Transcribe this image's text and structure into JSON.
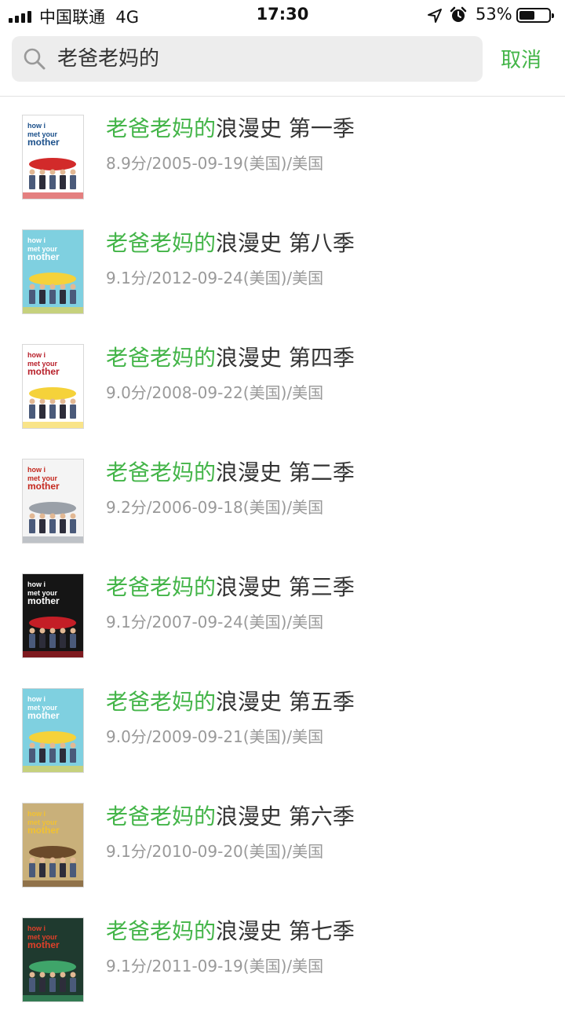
{
  "status_bar": {
    "carrier": "中国联通",
    "network": "4G",
    "time": "17:30",
    "battery": "53%",
    "battery_level": 0.53
  },
  "search": {
    "query": "老爸老妈的",
    "cancel_label": "取消"
  },
  "colors": {
    "accent": "#44b549",
    "meta": "#999999"
  },
  "results": [
    {
      "highlight": "老爸老妈的",
      "rest": "浪漫史 第一季",
      "meta": "8.9分/2005-09-19(美国)/美国"
    },
    {
      "highlight": "老爸老妈的",
      "rest": "浪漫史 第八季",
      "meta": "9.1分/2012-09-24(美国)/美国"
    },
    {
      "highlight": "老爸老妈的",
      "rest": "浪漫史 第四季",
      "meta": "9.0分/2008-09-22(美国)/美国"
    },
    {
      "highlight": "老爸老妈的",
      "rest": "浪漫史 第二季",
      "meta": "9.2分/2006-09-18(美国)/美国"
    },
    {
      "highlight": "老爸老妈的",
      "rest": "浪漫史 第三季",
      "meta": "9.1分/2007-09-24(美国)/美国"
    },
    {
      "highlight": "老爸老妈的",
      "rest": "浪漫史 第五季",
      "meta": "9.0分/2009-09-21(美国)/美国"
    },
    {
      "highlight": "老爸老妈的",
      "rest": "浪漫史 第六季",
      "meta": "9.1分/2010-09-20(美国)/美国"
    },
    {
      "highlight": "老爸老妈的",
      "rest": "浪漫史 第七季",
      "meta": "9.1分/2011-09-19(美国)/美国"
    }
  ],
  "posters": [
    {
      "text": "how i met your mother",
      "bg": "#ffffff",
      "text_color": "#1a4f8a",
      "accent": "#d22a2a"
    },
    {
      "text": "how i met your mother",
      "bg": "#7fd0e0",
      "text_color": "#ffffff",
      "accent": "#f5d23a"
    },
    {
      "text": "how i met your mother",
      "bg": "#ffffff",
      "text_color": "#b8202a",
      "accent": "#f5d23a"
    },
    {
      "text": "how i met your mother",
      "bg": "#f4f4f4",
      "text_color": "#c4281e",
      "accent": "#9aa0a8"
    },
    {
      "text": "how i met your mother",
      "bg": "#151515",
      "text_color": "#ffffff",
      "accent": "#c41e26"
    },
    {
      "text": "how i met your mother",
      "bg": "#7fd0e0",
      "text_color": "#ffffff",
      "accent": "#f5d23a"
    },
    {
      "text": "how i met your mother",
      "bg": "#c9b07a",
      "text_color": "#f2c230",
      "accent": "#6b4a2a"
    },
    {
      "text": "how i met your mother",
      "bg": "#1f3a2f",
      "text_color": "#e0402a",
      "accent": "#3fa56a"
    }
  ]
}
